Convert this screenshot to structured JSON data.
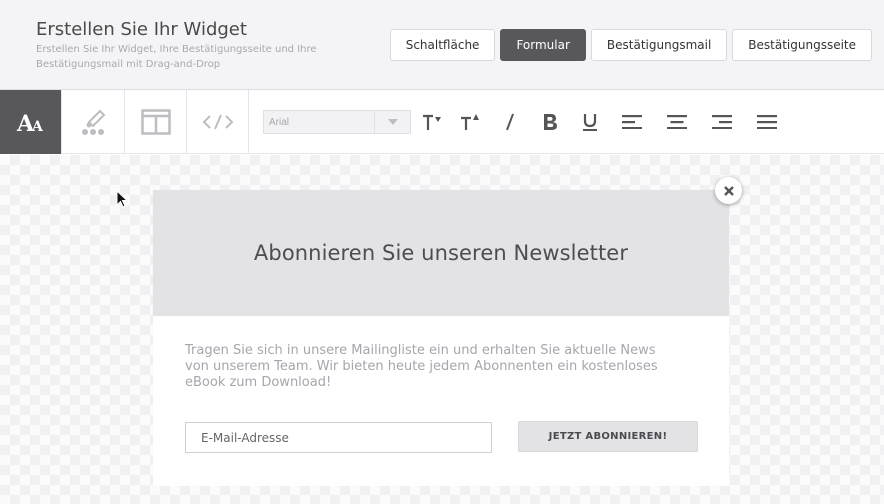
{
  "header": {
    "title": "Erstellen Sie Ihr Widget",
    "subtitle": "Erstellen Sie Ihr Widget, Ihre Bestätigungsseite und Ihre Bestätigungsmail mit Drag-and-Drop"
  },
  "tabs": [
    {
      "label": "Schaltfläche",
      "active": false
    },
    {
      "label": "Formular",
      "active": true
    },
    {
      "label": "Bestätigungsmail",
      "active": false
    },
    {
      "label": "Bestätigungsseite",
      "active": false
    }
  ],
  "toolbar": {
    "modes": [
      "text-style-icon",
      "design-icon",
      "layout-icon",
      "code-icon"
    ],
    "font_family_value": "Arial",
    "tools": [
      "decrease-font-size-icon",
      "increase-font-size-icon",
      "italic-icon",
      "bold-icon",
      "underline-icon",
      "align-left-icon",
      "align-center-icon",
      "align-right-icon",
      "justify-icon"
    ]
  },
  "widget": {
    "title": "Abonnieren Sie unseren Newsletter",
    "body": "Tragen Sie sich in unsere Mailingliste ein und erhalten Sie aktuelle News von unserem Team. Wir bieten heute jedem Abonnenten ein kostenloses eBook zum Download!",
    "email_placeholder": "E-Mail-Adresse",
    "subscribe_label": "JETZT ABONNIEREN!"
  },
  "colors": {
    "active_tab": "#58585c",
    "header_bg": "#f4f4f7",
    "widget_head_bg": "#e3e3e6"
  }
}
